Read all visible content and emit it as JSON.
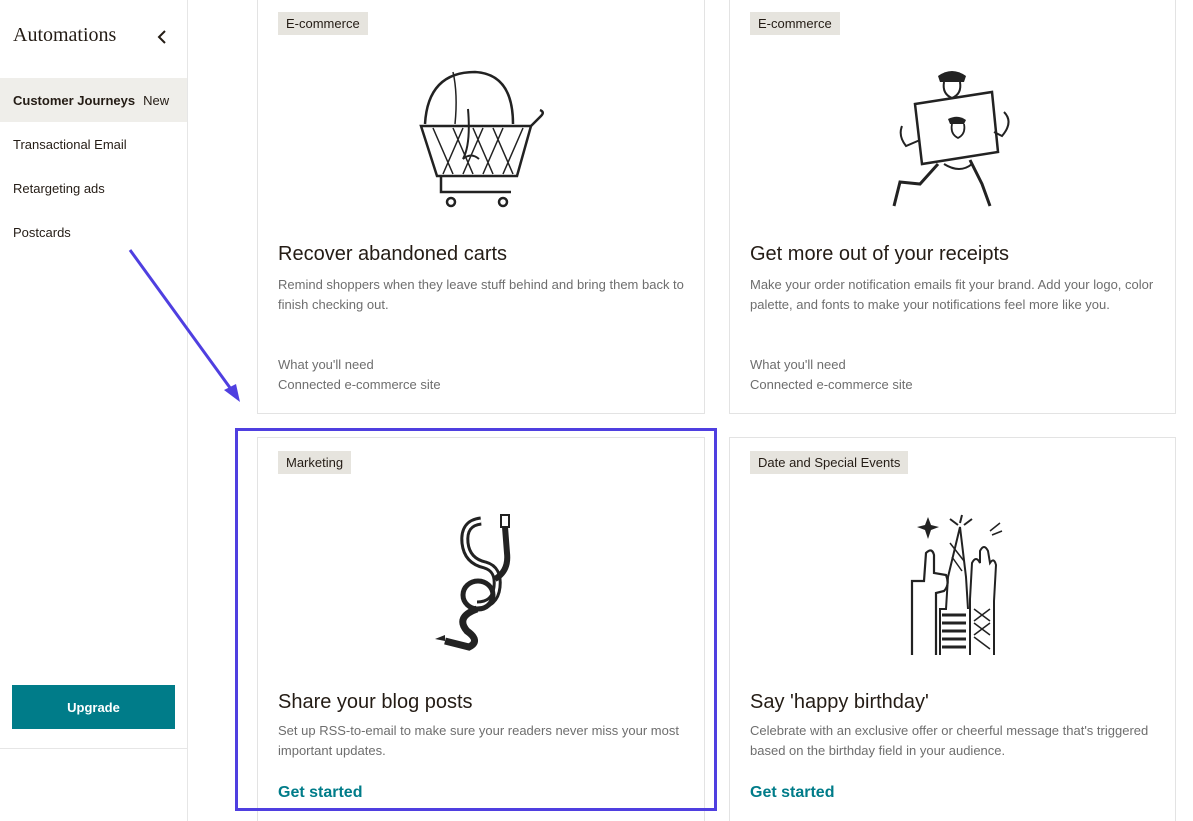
{
  "sidebar": {
    "title": "Automations",
    "items": [
      {
        "label": "Customer Journeys",
        "badge": "New"
      },
      {
        "label": "Transactional Email"
      },
      {
        "label": "Retargeting ads"
      },
      {
        "label": "Postcards"
      }
    ],
    "upgrade_label": "Upgrade"
  },
  "cards": [
    {
      "tag": "E-commerce",
      "title": "Recover abandoned carts",
      "description": "Remind shoppers when they leave stuff behind and bring them back to finish checking out.",
      "need_label": "What you'll need",
      "need_value": "Connected e-commerce site",
      "illustration": "shopping-cart-character"
    },
    {
      "tag": "E-commerce",
      "title": "Get more out of your receipts",
      "description": "Make your order notification emails fit your brand. Add your logo, color palette, and fonts to make your notifications feel more like you.",
      "need_label": "What you'll need",
      "need_value": "Connected e-commerce site",
      "illustration": "running-figure-with-sign"
    },
    {
      "tag": "Marketing",
      "title": "Share your blog posts",
      "description": "Set up RSS-to-email to make sure your readers never miss your most important updates.",
      "cta": "Get started",
      "illustration": "pencil-link-chain"
    },
    {
      "tag": "Date and Special Events",
      "title": "Say 'happy birthday'",
      "description": "Celebrate with an exclusive offer or cheerful message that's triggered based on the birthday field in your audience.",
      "cta": "Get started",
      "illustration": "celebrating-hands"
    }
  ],
  "colors": {
    "accent": "#007c89",
    "highlight": "#4f3fe0",
    "tag_bg": "#e6e4de",
    "active_bg": "#efeeea"
  }
}
